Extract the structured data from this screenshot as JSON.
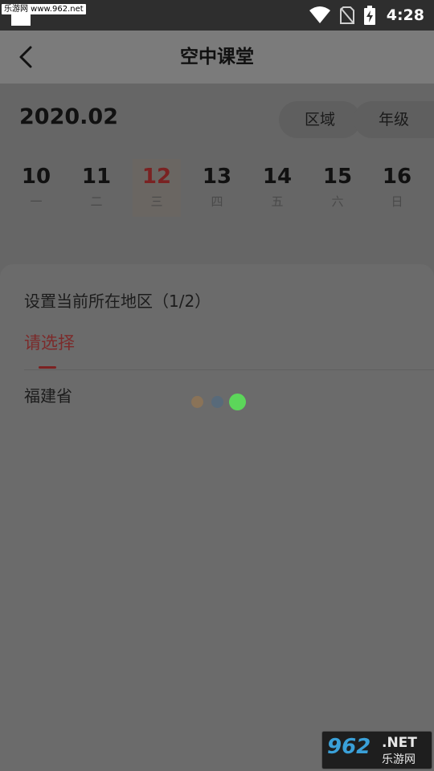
{
  "status_bar": {
    "watermark": "乐游网 www.962.net",
    "time": "4:28",
    "icons": [
      "wifi-icon",
      "no-sim-icon",
      "battery-charging-icon"
    ]
  },
  "header": {
    "title": "空中课堂",
    "back_icon": "chevron-left-icon"
  },
  "calendar": {
    "month": "2020.02",
    "filters": {
      "region": "区域",
      "grade": "年级"
    },
    "days": [
      {
        "num": "10",
        "weekday": "一"
      },
      {
        "num": "11",
        "weekday": "二"
      },
      {
        "num": "12",
        "weekday": "三",
        "selected": true
      },
      {
        "num": "13",
        "weekday": "四"
      },
      {
        "num": "14",
        "weekday": "五"
      },
      {
        "num": "15",
        "weekday": "六"
      },
      {
        "num": "16",
        "weekday": "日"
      }
    ]
  },
  "sheet": {
    "title": "设置当前所在地区（1/2）",
    "active_tab": "请选择",
    "items": [
      "福建省"
    ]
  },
  "watermark_bottom": {
    "logo": "962",
    "net": ".NET",
    "cn": "乐游网"
  },
  "colors": {
    "accent": "#7c2a2a",
    "loading_dot_1": "#8a7358",
    "loading_dot_2": "#586a7a",
    "loading_dot_3": "#5cd65a"
  }
}
